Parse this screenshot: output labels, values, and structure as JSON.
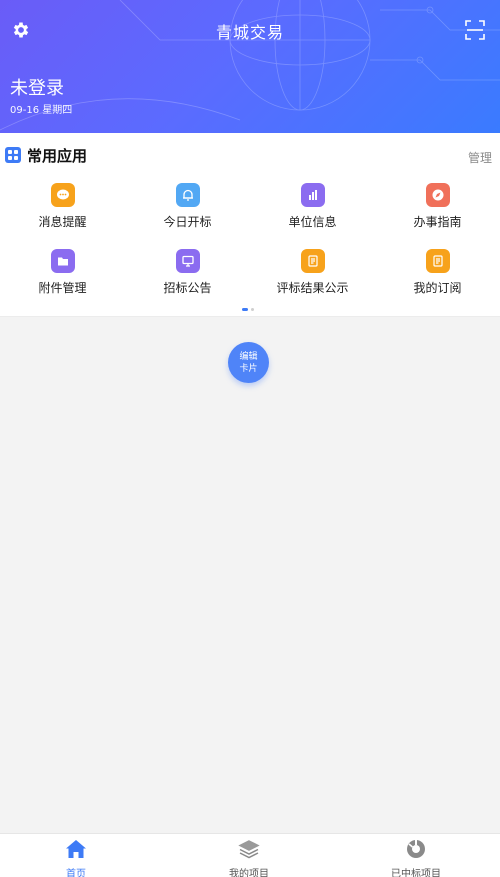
{
  "header": {
    "title": "青城交易",
    "login_status": "未登录",
    "date": "09-16 星期四"
  },
  "apps_card": {
    "title": "常用应用",
    "manage_label": "管理",
    "items": [
      {
        "label": "消息提醒",
        "icon": "message-icon",
        "color": "#f7a21b"
      },
      {
        "label": "今日开标",
        "icon": "bell-icon",
        "color": "#52a8f4"
      },
      {
        "label": "单位信息",
        "icon": "bar-chart-icon",
        "color": "#8b6cf0"
      },
      {
        "label": "办事指南",
        "icon": "compass-icon",
        "color": "#f0705a"
      },
      {
        "label": "附件管理",
        "icon": "folder-icon",
        "color": "#8b6cf0"
      },
      {
        "label": "招标公告",
        "icon": "monitor-icon",
        "color": "#8b6cf0"
      },
      {
        "label": "评标结果公示",
        "icon": "document-icon",
        "color": "#f7a21b"
      },
      {
        "label": "我的订阅",
        "icon": "document-icon",
        "color": "#f7a21b"
      }
    ],
    "page_count": 2,
    "active_page": 1
  },
  "edit_card": {
    "line1": "编辑",
    "line2": "卡片"
  },
  "tabbar": {
    "items": [
      {
        "label": "首页",
        "icon": "home-icon",
        "active": true
      },
      {
        "label": "我的项目",
        "icon": "layers-icon",
        "active": false
      },
      {
        "label": "已中标项目",
        "icon": "award-icon",
        "active": false
      }
    ]
  },
  "colors": {
    "accent": "#3e7bf6",
    "header_start": "#6a5cf7",
    "header_end": "#3a7bff"
  }
}
